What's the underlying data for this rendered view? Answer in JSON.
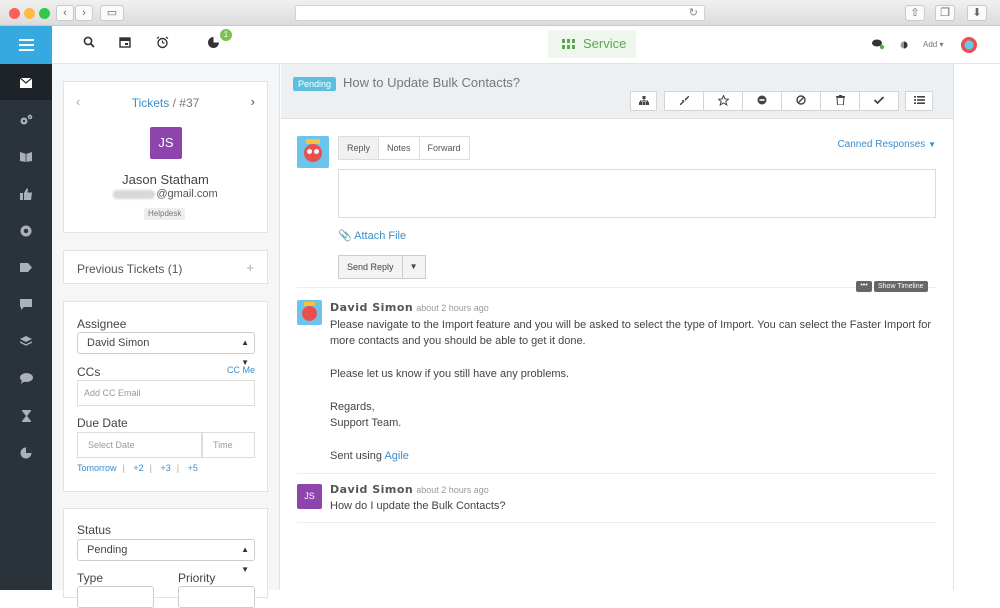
{
  "topbar": {
    "service_label": "Service",
    "notification_count": "1",
    "add_label": "Add"
  },
  "ticket_card": {
    "breadcrumb_prefix": "Tickets",
    "ticket_number": " / #37",
    "initials": "JS",
    "name": "Jason Statham",
    "email_visible": "@gmail.com",
    "tag": "Helpdesk"
  },
  "previous_tickets": {
    "label": "Previous Tickets (1)",
    "expand": "+"
  },
  "details": {
    "assignee_label": "Assignee",
    "assignee_value": "David Simon",
    "ccs_label": "CCs",
    "cc_me": "CC Me",
    "cc_placeholder": "Add CC Email",
    "due_label": "Due Date",
    "date_placeholder": "Select Date",
    "time_placeholder": "Time",
    "quick_dates": [
      "Tomorrow",
      "+2",
      "+3",
      "+5"
    ]
  },
  "status_card": {
    "status_label": "Status",
    "status_value": "Pending",
    "type_label": "Type",
    "priority_label": "Priority"
  },
  "ticket": {
    "status_badge": "Pending",
    "subject": "How to Update Bulk Contacts?"
  },
  "reply": {
    "tabs": [
      "Reply",
      "Notes",
      "Forward"
    ],
    "canned": "Canned Responses",
    "attach": "Attach File",
    "send": "Send Reply",
    "timeline_dots": "•••",
    "show_timeline": "Show Timeline"
  },
  "messages": [
    {
      "author": "David Simon",
      "time": "about 2 hours ago",
      "lines": [
        "Please navigate to the Import feature and you will be asked to select the type of Import. You can select the Faster Import for",
        "more contacts and you should be able to get it done.",
        "Please let us know if you still have any problems.",
        "Regards,",
        "Support Team."
      ],
      "sent_prefix": "Sent using ",
      "sent_link": "Agile"
    },
    {
      "author": "David Simon",
      "initials": "JS",
      "time": "about 2 hours ago",
      "lines": [
        "How do I update the Bulk Contacts?"
      ]
    }
  ],
  "colors": {
    "accent": "#36a9e1",
    "sidebar": "#2b333a",
    "link": "#3a8dca",
    "avatar_purple": "#8e44ad",
    "service_green": "#5aa84f"
  }
}
